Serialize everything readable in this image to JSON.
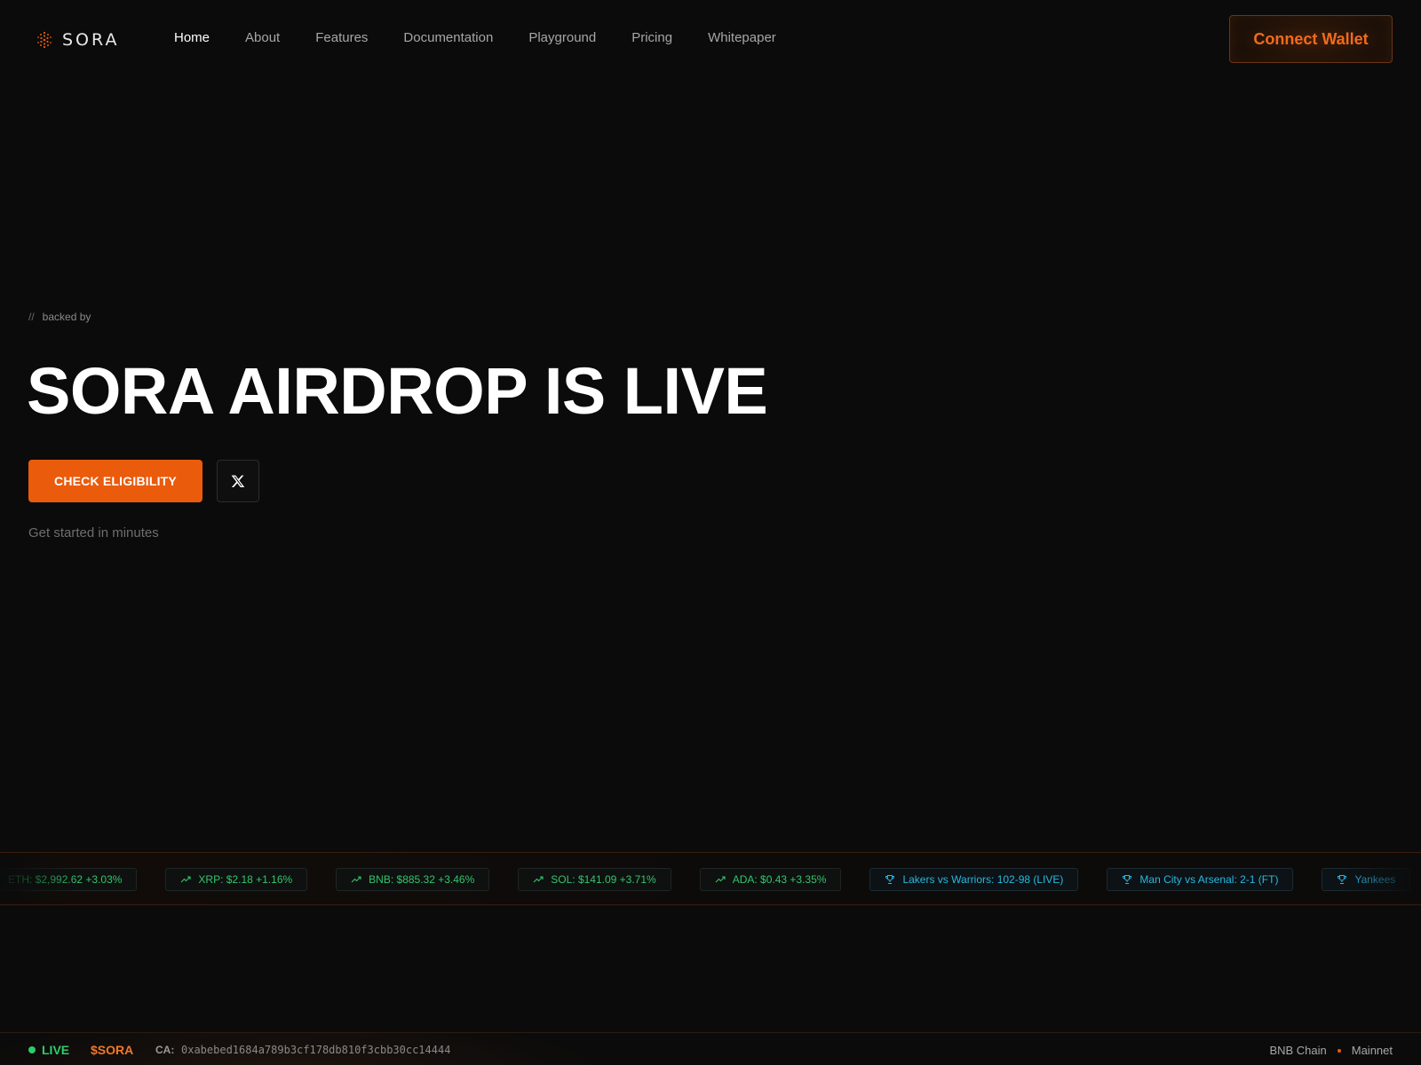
{
  "brand": {
    "name": "SORA",
    "accent": "#ea5b0c"
  },
  "nav": {
    "links": [
      "Home",
      "About",
      "Features",
      "Documentation",
      "Playground",
      "Pricing",
      "Whitepaper"
    ],
    "active": "Home",
    "connect_label": "Connect Wallet"
  },
  "hero": {
    "tag_prefix": "//",
    "tag_text": "backed by",
    "title": "SORA AIRDROP IS LIVE",
    "cta_label": "CHECK ELIGIBILITY",
    "social_icon": "x-logo-icon",
    "subtitle": "Get started in minutes"
  },
  "ticker": {
    "items": [
      {
        "kind": "crypto",
        "icon": "trending-up-icon",
        "text": "ETH: $2,992.62 +3.03%"
      },
      {
        "kind": "crypto",
        "icon": "trending-up-icon",
        "text": "XRP: $2.18 +1.16%"
      },
      {
        "kind": "crypto",
        "icon": "trending-up-icon",
        "text": "BNB: $885.32 +3.46%"
      },
      {
        "kind": "crypto",
        "icon": "trending-up-icon",
        "text": "SOL: $141.09 +3.71%"
      },
      {
        "kind": "crypto",
        "icon": "trending-up-icon",
        "text": "ADA: $0.43 +3.35%"
      },
      {
        "kind": "sport",
        "icon": "trophy-icon",
        "text": "Lakers vs Warriors: 102-98 (LIVE)"
      },
      {
        "kind": "sport",
        "icon": "trophy-icon",
        "text": "Man City vs Arsenal: 2-1 (FT)"
      },
      {
        "kind": "sport",
        "icon": "trophy-icon",
        "text": "Yankees"
      }
    ],
    "colors": {
      "crypto": "#35c46a",
      "sport": "#2ab8e0"
    }
  },
  "status": {
    "live_label": "LIVE",
    "symbol": "$SORA",
    "ca_label": "CA:",
    "ca_value": "0xabebed1684a789b3cf178db810f3cbb30cc14444",
    "chain": "BNB Chain",
    "network": "Mainnet"
  }
}
